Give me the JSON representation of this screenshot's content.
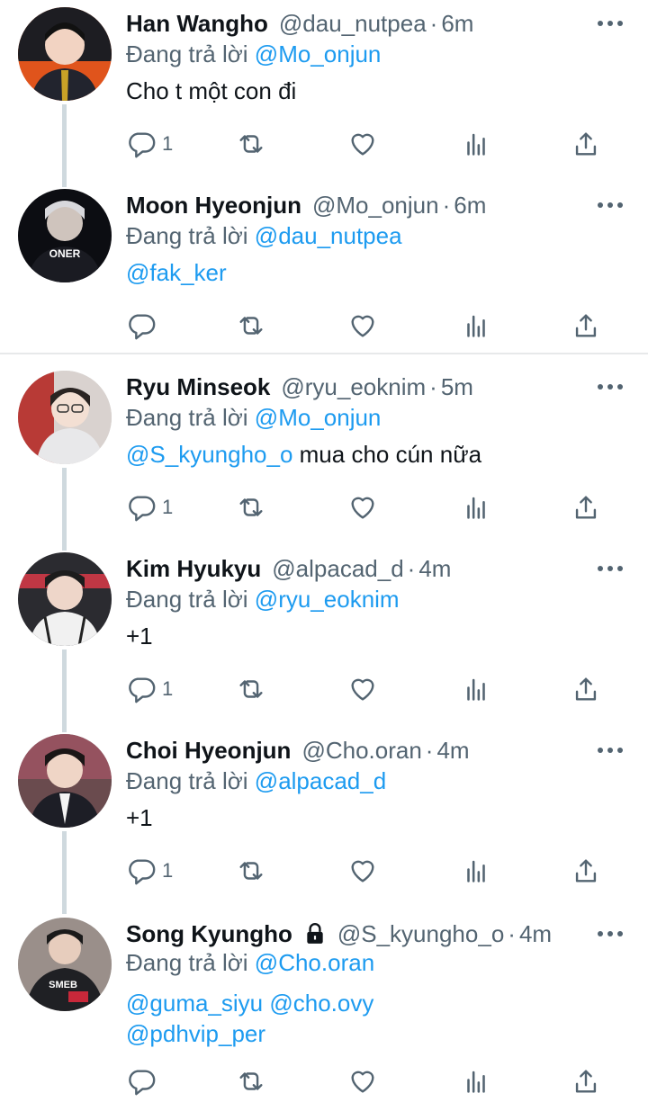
{
  "ui": {
    "reply_prefix": "Đang trả lời",
    "dot": "·",
    "accent": "#1d9bf0",
    "muted": "#536471"
  },
  "tweets": [
    {
      "name": "Han Wangho",
      "handle": "@dau_nutpea",
      "time": "6m",
      "reply_to": "@Mo_onjun",
      "body_mentions": "",
      "body_text": "Cho t một con đi",
      "reply_count": "1"
    },
    {
      "name": "Moon Hyeonjun",
      "handle": "@Mo_onjun",
      "time": "6m",
      "reply_to": "@dau_nutpea",
      "body_mentions": "@fak_ker",
      "body_text": "",
      "reply_count": ""
    },
    {
      "name": "Ryu Minseok",
      "handle": "@ryu_eoknim",
      "time": "5m",
      "reply_to": "@Mo_onjun",
      "body_mentions": "@S_kyungho_o",
      "body_text": " mua cho cún nữa",
      "reply_count": "1"
    },
    {
      "name": "Kim Hyukyu",
      "handle": "@alpacad_d",
      "time": "4m",
      "reply_to": "@ryu_eoknim",
      "body_mentions": "",
      "body_text": "+1",
      "reply_count": "1"
    },
    {
      "name": "Choi Hyeonjun",
      "handle": "@Cho.oran",
      "time": "4m",
      "reply_to": "@alpacad_d",
      "body_mentions": "",
      "body_text": "+1",
      "reply_count": "1"
    },
    {
      "name": "Song Kyungho",
      "handle": "@S_kyungho_o",
      "time": "4m",
      "reply_to": "@Cho.oran",
      "body_mentions_line1": "@guma_siyu @cho.ovy",
      "body_mentions_line2": "@pdhvip_per",
      "reply_count": "",
      "locked": true
    }
  ]
}
